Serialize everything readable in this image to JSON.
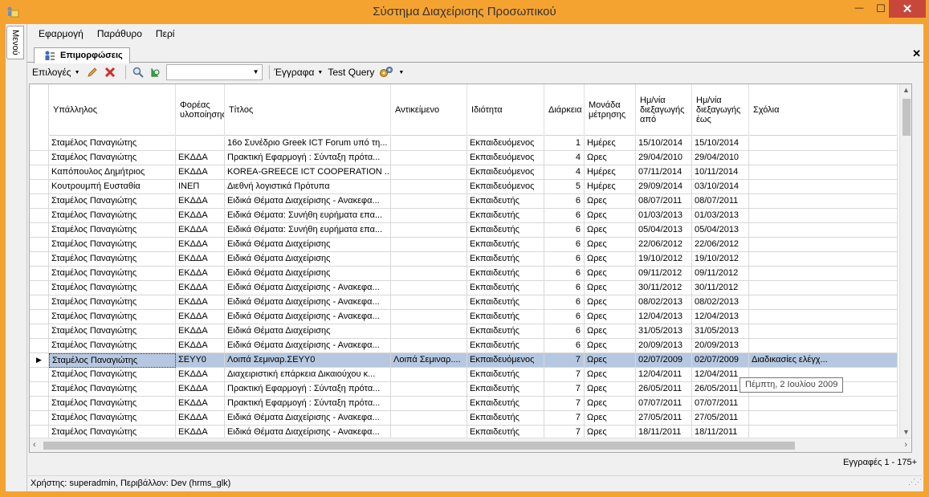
{
  "window": {
    "title": "Σύστημα Διαχείρισης Προσωπικού",
    "close_glyph": "✕",
    "min_glyph": "—",
    "max_glyph": "☐"
  },
  "side_tab": {
    "label": "Μενού"
  },
  "menu": [
    "Εφαρμογή",
    "Παράθυρο",
    "Περί"
  ],
  "tab": {
    "label": "Επιμορφώσεις",
    "close_glyph": "✕"
  },
  "toolbar": {
    "options_label": "Επιλογές",
    "search_value": "",
    "documents_label": "Έγγραφα",
    "test_query_label": "Test Query"
  },
  "grid": {
    "columns": [
      {
        "key": "employee",
        "label": "Υπάλληλος"
      },
      {
        "key": "agency",
        "label": "Φορέας υλοποίησης"
      },
      {
        "key": "title",
        "label": "Τίτλος"
      },
      {
        "key": "subject",
        "label": "Αντικείμενο"
      },
      {
        "key": "role",
        "label": "Ιδιότητα"
      },
      {
        "key": "duration",
        "label": "Διάρκεια"
      },
      {
        "key": "unit",
        "label": "Μονάδα μέτρησης"
      },
      {
        "key": "date_from",
        "label": "Ημ/νία διεξαγωγής από"
      },
      {
        "key": "date_to",
        "label": "Ημ/νία διεξαγωγής έως"
      },
      {
        "key": "comments",
        "label": "Σχόλια"
      }
    ],
    "rows": [
      [
        "Σταμέλος Παναγιώτης",
        "",
        "16ο Συνέδριο Greek ICT Forum υπό τη...",
        "",
        "Εκπαιδευόμενος",
        "1",
        "Ημέρες",
        "15/10/2014",
        "15/10/2014",
        ""
      ],
      [
        "Σταμέλος Παναγιώτης",
        "ΕΚΔΔΑ",
        "Πρακτική Εφαρμογή : Σύνταξη πρότα...",
        "",
        "Εκπαιδευόμενος",
        "4",
        "Ωρες",
        "29/04/2010",
        "29/04/2010",
        ""
      ],
      [
        "Καπόπουλος Δημήτριος",
        "ΕΚΔΔΑ",
        "KOREA-GREECE ICT COOPERATION ...",
        "",
        "Εκπαιδευόμενος",
        "4",
        "Ημέρες",
        "07/11/2014",
        "10/11/2014",
        ""
      ],
      [
        "Κουτρουμπή Ευσταθία",
        "ΙΝΕΠ",
        "Διεθνή λογιστικά Πρότυπα",
        "",
        "Εκπαιδευόμενος",
        "5",
        "Ημέρες",
        "29/09/2014",
        "03/10/2014",
        ""
      ],
      [
        "Σταμέλος Παναγιώτης",
        "ΕΚΔΔΑ",
        "Ειδικά Θέματα Διαχείρισης - Ανακεφα...",
        "",
        "Εκπαιδευτής",
        "6",
        "Ωρες",
        "08/07/2011",
        "08/07/2011",
        ""
      ],
      [
        "Σταμέλος Παναγιώτης",
        "ΕΚΔΔΑ",
        "Ειδικά Θέματα: Συνήθη ευρήματα επα...",
        "",
        "Εκπαιδευτής",
        "6",
        "Ωρες",
        "01/03/2013",
        "01/03/2013",
        ""
      ],
      [
        "Σταμέλος Παναγιώτης",
        "ΕΚΔΔΑ",
        "Ειδικά Θέματα: Συνήθη ευρήματα επα...",
        "",
        "Εκπαιδευτής",
        "6",
        "Ωρες",
        "05/04/2013",
        "05/04/2013",
        ""
      ],
      [
        "Σταμέλος Παναγιώτης",
        "ΕΚΔΔΑ",
        "Ειδικά Θέματα Διαχείρισης",
        "",
        "Εκπαιδευτής",
        "6",
        "Ωρες",
        "22/06/2012",
        "22/06/2012",
        ""
      ],
      [
        "Σταμέλος Παναγιώτης",
        "ΕΚΔΔΑ",
        "Ειδικά Θέματα Διαχείρισης",
        "",
        "Εκπαιδευτής",
        "6",
        "Ωρες",
        "19/10/2012",
        "19/10/2012",
        ""
      ],
      [
        "Σταμέλος Παναγιώτης",
        "ΕΚΔΔΑ",
        "Ειδικά Θέματα Διαχείρισης",
        "",
        "Εκπαιδευτής",
        "6",
        "Ωρες",
        "09/11/2012",
        "09/11/2012",
        ""
      ],
      [
        "Σταμέλος Παναγιώτης",
        "ΕΚΔΔΑ",
        "Ειδικά Θέματα Διαχείρισης - Ανακεφα...",
        "",
        "Εκπαιδευτής",
        "6",
        "Ωρες",
        "30/11/2012",
        "30/11/2012",
        ""
      ],
      [
        "Σταμέλος Παναγιώτης",
        "ΕΚΔΔΑ",
        "Ειδικά Θέματα Διαχείρισης - Ανακεφα...",
        "",
        "Εκπαιδευτής",
        "6",
        "Ωρες",
        "08/02/2013",
        "08/02/2013",
        ""
      ],
      [
        "Σταμέλος Παναγιώτης",
        "ΕΚΔΔΑ",
        "Ειδικά Θέματα Διαχείρισης - Ανακεφα...",
        "",
        "Εκπαιδευτής",
        "6",
        "Ωρες",
        "12/04/2013",
        "12/04/2013",
        ""
      ],
      [
        "Σταμέλος Παναγιώτης",
        "ΕΚΔΔΑ",
        "Ειδικά Θέματα Διαχείρισης",
        "",
        "Εκπαιδευτής",
        "6",
        "Ωρες",
        "31/05/2013",
        "31/05/2013",
        ""
      ],
      [
        "Σταμέλος Παναγιώτης",
        "ΕΚΔΔΑ",
        "Ειδικά Θέματα Διαχείρισης - Ανακεφα...",
        "",
        "Εκπαιδευτής",
        "6",
        "Ωρες",
        "20/09/2013",
        "20/09/2013",
        ""
      ],
      [
        "Σταμέλος Παναγιώτης",
        "ΣΕΥΥ0",
        "Λοιπά Σεμιναρ.ΣΕΥΥ0",
        "Λοιπά Σεμιναρ....",
        "Εκπαιδευόμενος",
        "7",
        "Ωρες",
        "02/07/2009",
        "02/07/2009",
        "Διαδικασίες ελέγχ..."
      ],
      [
        "Σταμέλος Παναγιώτης",
        "ΕΚΔΔΑ",
        "Διαχειριστική επάρκεια Δικαιούχου κ...",
        "",
        "Εκπαιδευτής",
        "7",
        "Ωρες",
        "12/04/2011",
        "12/04/2011",
        ""
      ],
      [
        "Σταμέλος Παναγιώτης",
        "ΕΚΔΔΑ",
        "Πρακτική Εφαρμογή : Σύνταξη πρότα...",
        "",
        "Εκπαιδευτής",
        "7",
        "Ωρες",
        "26/05/2011",
        "26/05/2011",
        ""
      ],
      [
        "Σταμέλος Παναγιώτης",
        "ΕΚΔΔΑ",
        "Πρακτική Εφαρμογή : Σύνταξη πρότα...",
        "",
        "Εκπαιδευτής",
        "7",
        "Ωρες",
        "07/07/2011",
        "07/07/2011",
        ""
      ],
      [
        "Σταμέλος Παναγιώτης",
        "ΕΚΔΔΑ",
        "Ειδικά Θέματα Διαχείρισης - Ανακεφα...",
        "",
        "Εκπαιδευτής",
        "7",
        "Ωρες",
        "27/05/2011",
        "27/05/2011",
        ""
      ],
      [
        "Σταμέλος Παναγιώτης",
        "ΕΚΔΔΑ",
        "Ειδικά Θέματα Διαχείρισης - Ανακεφα...",
        "",
        "Εκπαιδευτής",
        "7",
        "Ωρες",
        "18/11/2011",
        "18/11/2011",
        ""
      ]
    ],
    "selected_row": 15,
    "row_indicator": "▶"
  },
  "tooltip": "Πέμπτη, 2 Ιουλίου 2009",
  "records_label": "Εγγραφές 1 - 175+",
  "status_text": "Χρήστης: superadmin, Περιβάλλον: Dev (hrms_glk)",
  "colors": {
    "title_bar": "#f5a330",
    "close_button": "#c7473b",
    "selection": "#b5c8e0"
  }
}
